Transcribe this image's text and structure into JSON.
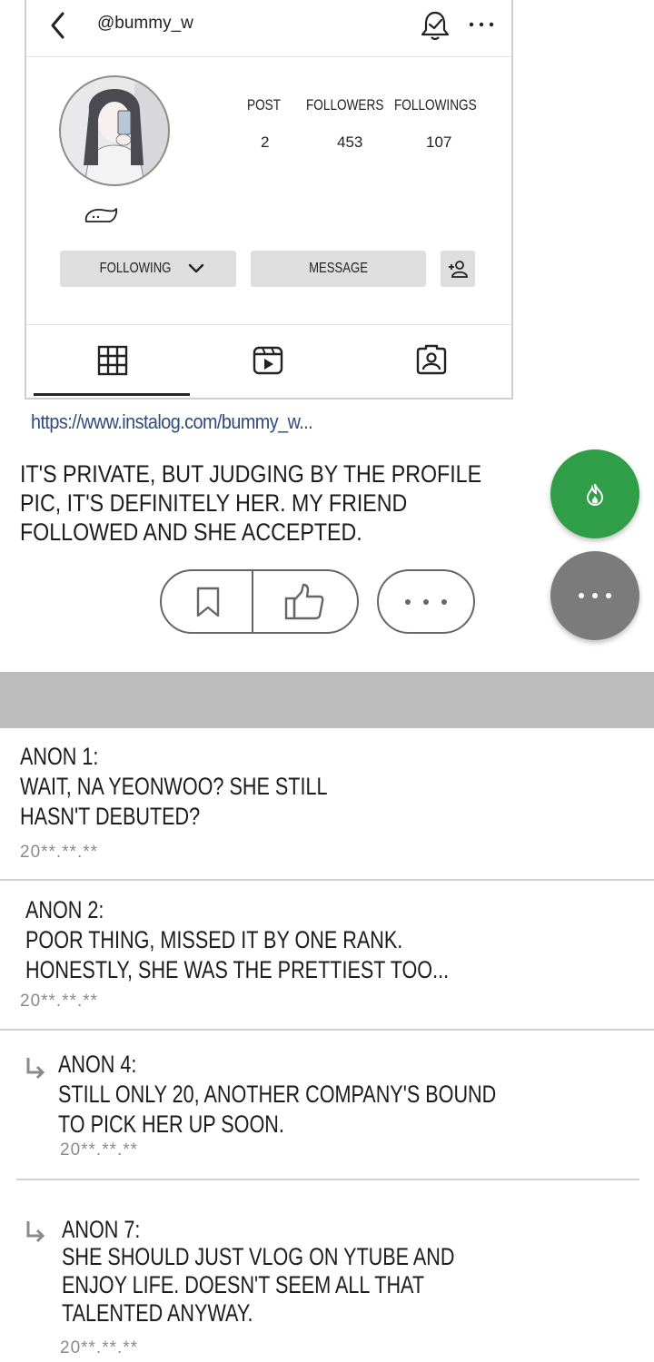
{
  "profile": {
    "username": "@bummy_w",
    "stats": [
      {
        "label": "POST",
        "value": "2"
      },
      {
        "label": "FOLLOWERS",
        "value": "453"
      },
      {
        "label": "FOLLOWINGS",
        "value": "107"
      }
    ],
    "following_button": "FOLLOWING",
    "message_button": "MESSAGE",
    "icons": {
      "back": "chevron-left-icon",
      "bell": "bell-check-icon",
      "more": "more-horizontal-icon",
      "add_user": "add-user-icon",
      "grid": "grid-icon",
      "reels": "reels-icon",
      "tagged": "tagged-user-icon",
      "pet": "pet-emoji-icon"
    }
  },
  "link": "https://www.instalog.com/bummy_w...",
  "post": {
    "lines": [
      "IT'S PRIVATE, BUT JUDGING BY THE PROFILE",
      "PIC, IT'S DEFINITELY HER. MY FRIEND",
      "FOLLOWED AND SHE ACCEPTED."
    ]
  },
  "colors": {
    "fab_green": "#2f9e47",
    "fab_grey": "#7b7b7b",
    "divider": "#bdbdbd",
    "link": "#2f4b7c"
  },
  "comments": [
    {
      "name": "ANON 1:",
      "lines": [
        "WAIT, NA YEONWOO? SHE STILL",
        "HASN'T DEBUTED?"
      ],
      "date": "20**.**.**",
      "reply": false
    },
    {
      "name": "ANON 2:",
      "lines": [
        "POOR THING, MISSED IT BY ONE RANK.",
        "HONESTLY, SHE WAS THE PRETTIEST TOO..."
      ],
      "date": "20**.**.**",
      "reply": false
    },
    {
      "name": "ANON 4:",
      "lines": [
        "STILL ONLY 20, ANOTHER COMPANY'S BOUND",
        "TO PICK HER UP SOON."
      ],
      "date": "20**.**.**",
      "reply": true
    },
    {
      "name": "ANON 7:",
      "lines": [
        "SHE SHOULD JUST VLOG ON YTUBE AND",
        "ENJOY LIFE. DOESN'T SEEM ALL THAT",
        "TALENTED ANYWAY."
      ],
      "date": "20**.**.**",
      "reply": true
    }
  ]
}
